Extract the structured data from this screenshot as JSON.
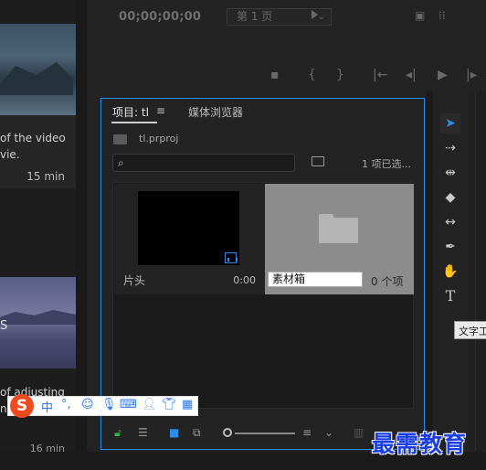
{
  "learn_panel": {
    "card1_text": "of the video\nvie.",
    "card1_duration": "15 min",
    "card2_letter": "S",
    "card2_text": "of adjusting\nng",
    "card2_duration": "16 min"
  },
  "monitor": {
    "timecode": "00;00;00;00",
    "page_select": "第 1 页"
  },
  "project_panel": {
    "tab_project": "项目: tl",
    "tab_media_browser": "媒体浏览器",
    "project_file": "tl.prproj",
    "search_placeholder": "",
    "selection_count": "1 项已选...",
    "items": [
      {
        "name": "片头",
        "duration": "0:00"
      },
      {
        "name": "素材箱",
        "count": "0 个项"
      }
    ]
  },
  "tools": {
    "tooltip": "文字工"
  },
  "ime": {
    "logo": "S",
    "lang": "中"
  },
  "watermark": "最需教育",
  "colors": {
    "accent_blue": "#2d8ceb",
    "lock_green": "#2fb84a"
  }
}
